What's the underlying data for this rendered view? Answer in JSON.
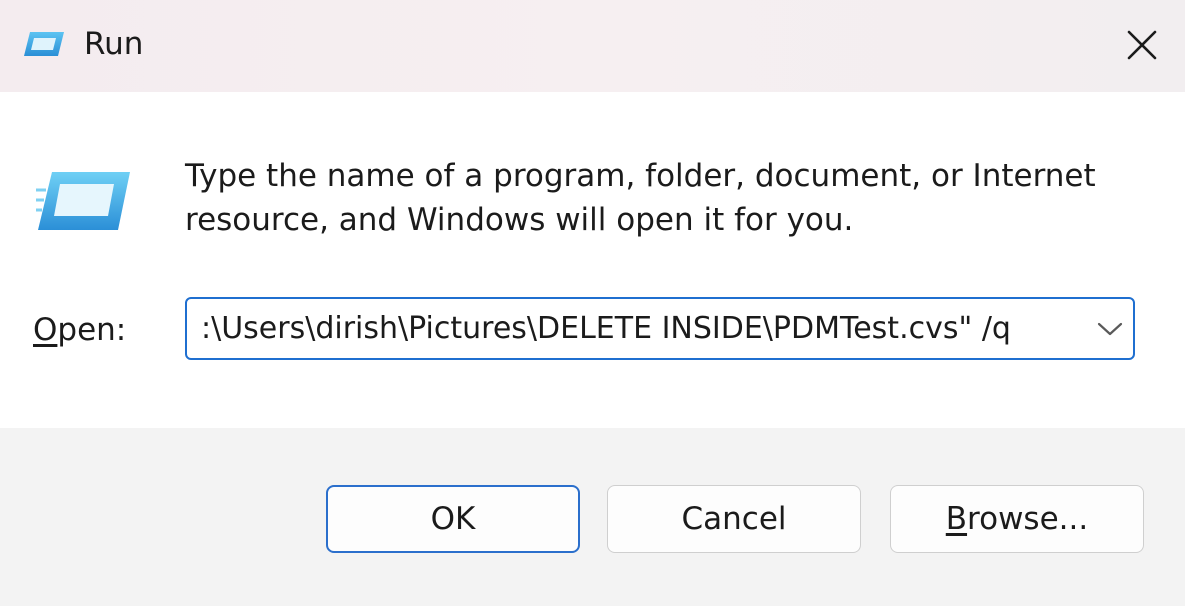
{
  "window": {
    "title": "Run",
    "icon": "run-icon",
    "close_icon": "close-icon"
  },
  "content": {
    "description": "Type the name of a program, folder, document, or Internet resource, and Windows will open it for you.",
    "open_label_accel": "O",
    "open_label_rest": "pen:",
    "open_value": ":\\Users\\dirish\\Pictures\\DELETE INSIDE\\PDMTest.cvs\" /q",
    "dropdown_icon": "chevron-down-icon"
  },
  "buttons": {
    "ok": "OK",
    "cancel": "Cancel",
    "browse_accel": "B",
    "browse_rest": "rowse..."
  },
  "colors": {
    "accent": "#1f6fd0",
    "icon_blue": "#3aa0e0",
    "footer_bg": "#f3f3f3"
  }
}
